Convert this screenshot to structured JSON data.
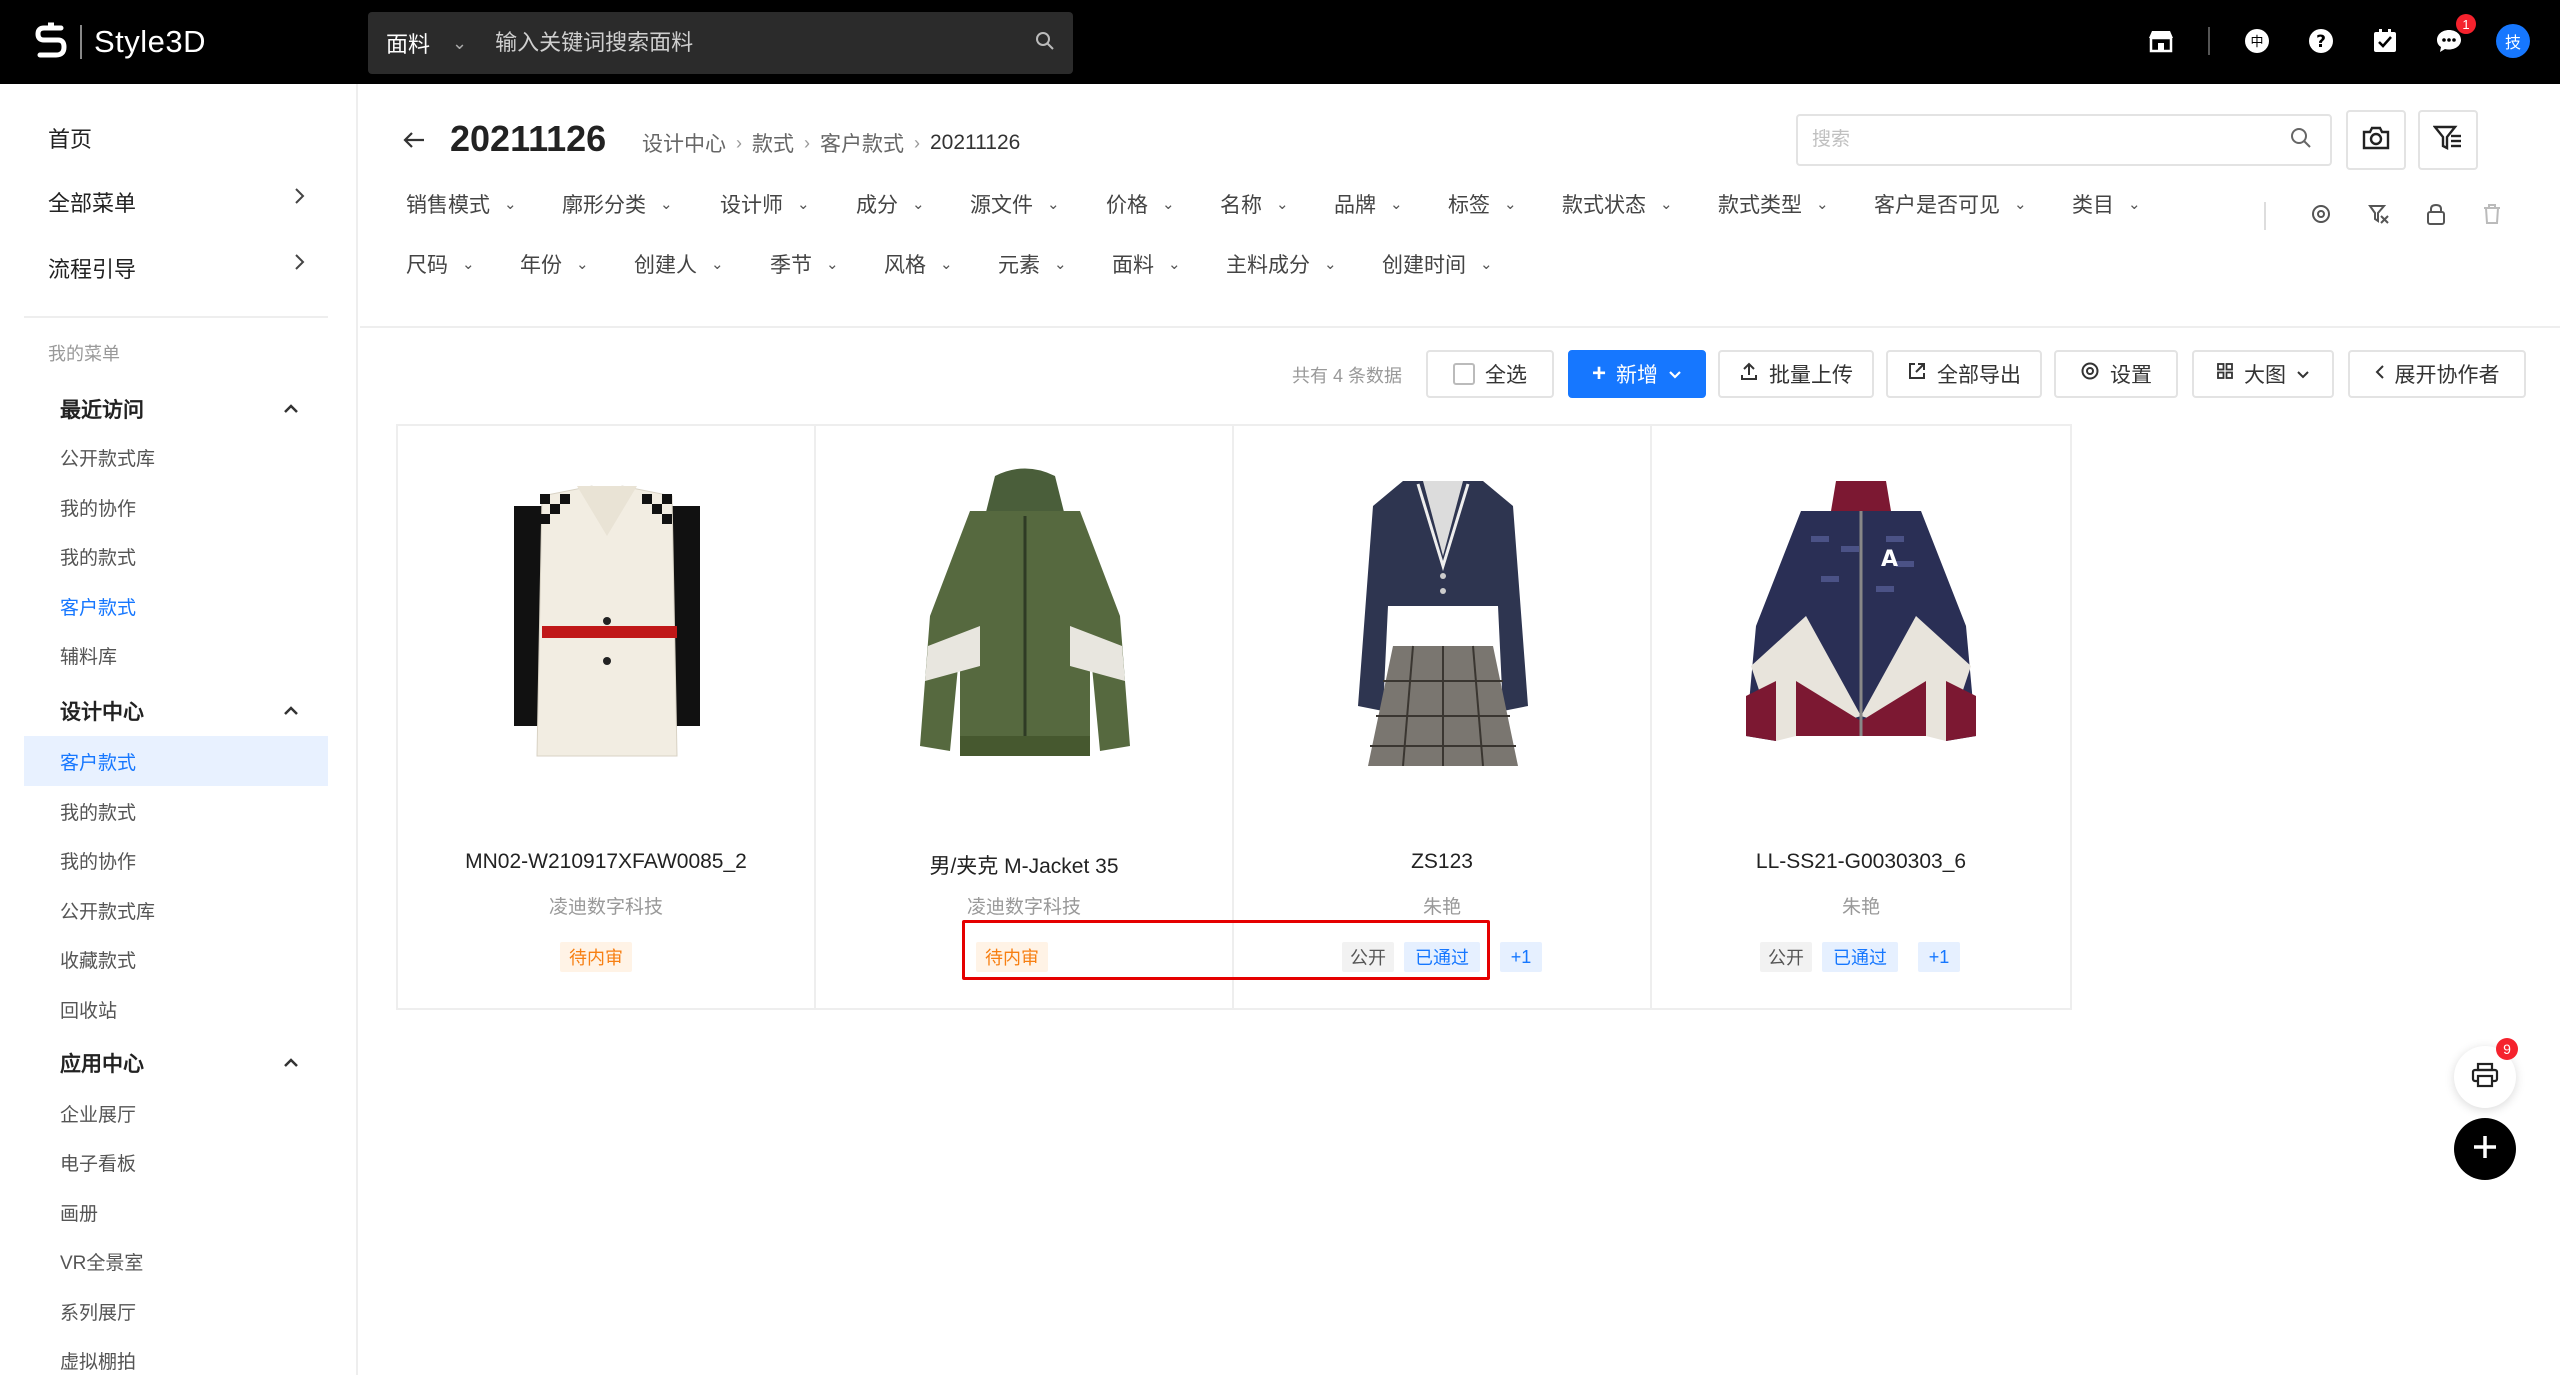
{
  "app": {
    "name": "Style3D"
  },
  "top_search": {
    "category": "面料",
    "placeholder": "输入关键词搜索面料"
  },
  "top_icons": {
    "message_badge": "1",
    "avatar_text": "技"
  },
  "sidebar": {
    "top_items": [
      "首页",
      "全部菜单",
      "流程引导"
    ],
    "my_menu_caption": "我的菜单",
    "groups": [
      {
        "title": "最近访问",
        "items": [
          "公开款式库",
          "我的协作",
          "我的款式",
          "客户款式",
          "辅料库"
        ]
      },
      {
        "title": "设计中心",
        "items": [
          "客户款式",
          "我的款式",
          "我的协作",
          "公开款式库",
          "收藏款式",
          "回收站"
        ]
      },
      {
        "title": "应用中心",
        "items": [
          "企业展厅",
          "电子看板",
          "画册",
          "VR全景室",
          "系列展厅",
          "虚拟棚拍"
        ]
      }
    ]
  },
  "header": {
    "title": "20211126",
    "breadcrumb": [
      "设计中心",
      "款式",
      "客户款式",
      "20211126"
    ],
    "search_placeholder": "搜索"
  },
  "filters": {
    "row1": [
      "销售模式",
      "廓形分类",
      "设计师",
      "成分",
      "源文件",
      "价格",
      "名称",
      "品牌",
      "标签",
      "款式状态",
      "款式类型",
      "客户是否可见",
      "类目"
    ],
    "row2": [
      "尺码",
      "年份",
      "创建人",
      "季节",
      "风格",
      "元素",
      "面料",
      "主料成分",
      "创建时间"
    ]
  },
  "toolbar": {
    "count_text": "共有 4 条数据",
    "select_all": "全选",
    "add": "新增",
    "batch_upload": "批量上传",
    "export_all": "全部导出",
    "settings": "设置",
    "view_mode": "大图",
    "expand_collaborators": "展开协作者"
  },
  "cards": [
    {
      "title": "MN02-W210917XFAW0085_2",
      "org": "凌迪数字科技",
      "tags": [
        {
          "text": "待内审",
          "kind": "warn"
        }
      ]
    },
    {
      "title": "男/夹克 M-Jacket 35",
      "org": "凌迪数字科技",
      "tags": [
        {
          "text": "待内审",
          "kind": "warn"
        }
      ]
    },
    {
      "title": "ZS123",
      "org": "朱艳",
      "tags": [
        {
          "text": "公开",
          "kind": "gray"
        },
        {
          "text": "已通过",
          "kind": "blue"
        },
        {
          "text": "+1",
          "kind": "blue"
        }
      ]
    },
    {
      "title": "LL-SS21-G0030303_6",
      "org": "朱艳",
      "tags": [
        {
          "text": "公开",
          "kind": "gray"
        },
        {
          "text": "已通过",
          "kind": "blue"
        },
        {
          "text": "+1",
          "kind": "blue"
        }
      ]
    }
  ],
  "floating": {
    "print_badge": "9"
  },
  "colors": {
    "accent": "#1677ff",
    "topbar": "#000000",
    "warn": "#f77f12",
    "highlight": "#e50000"
  }
}
